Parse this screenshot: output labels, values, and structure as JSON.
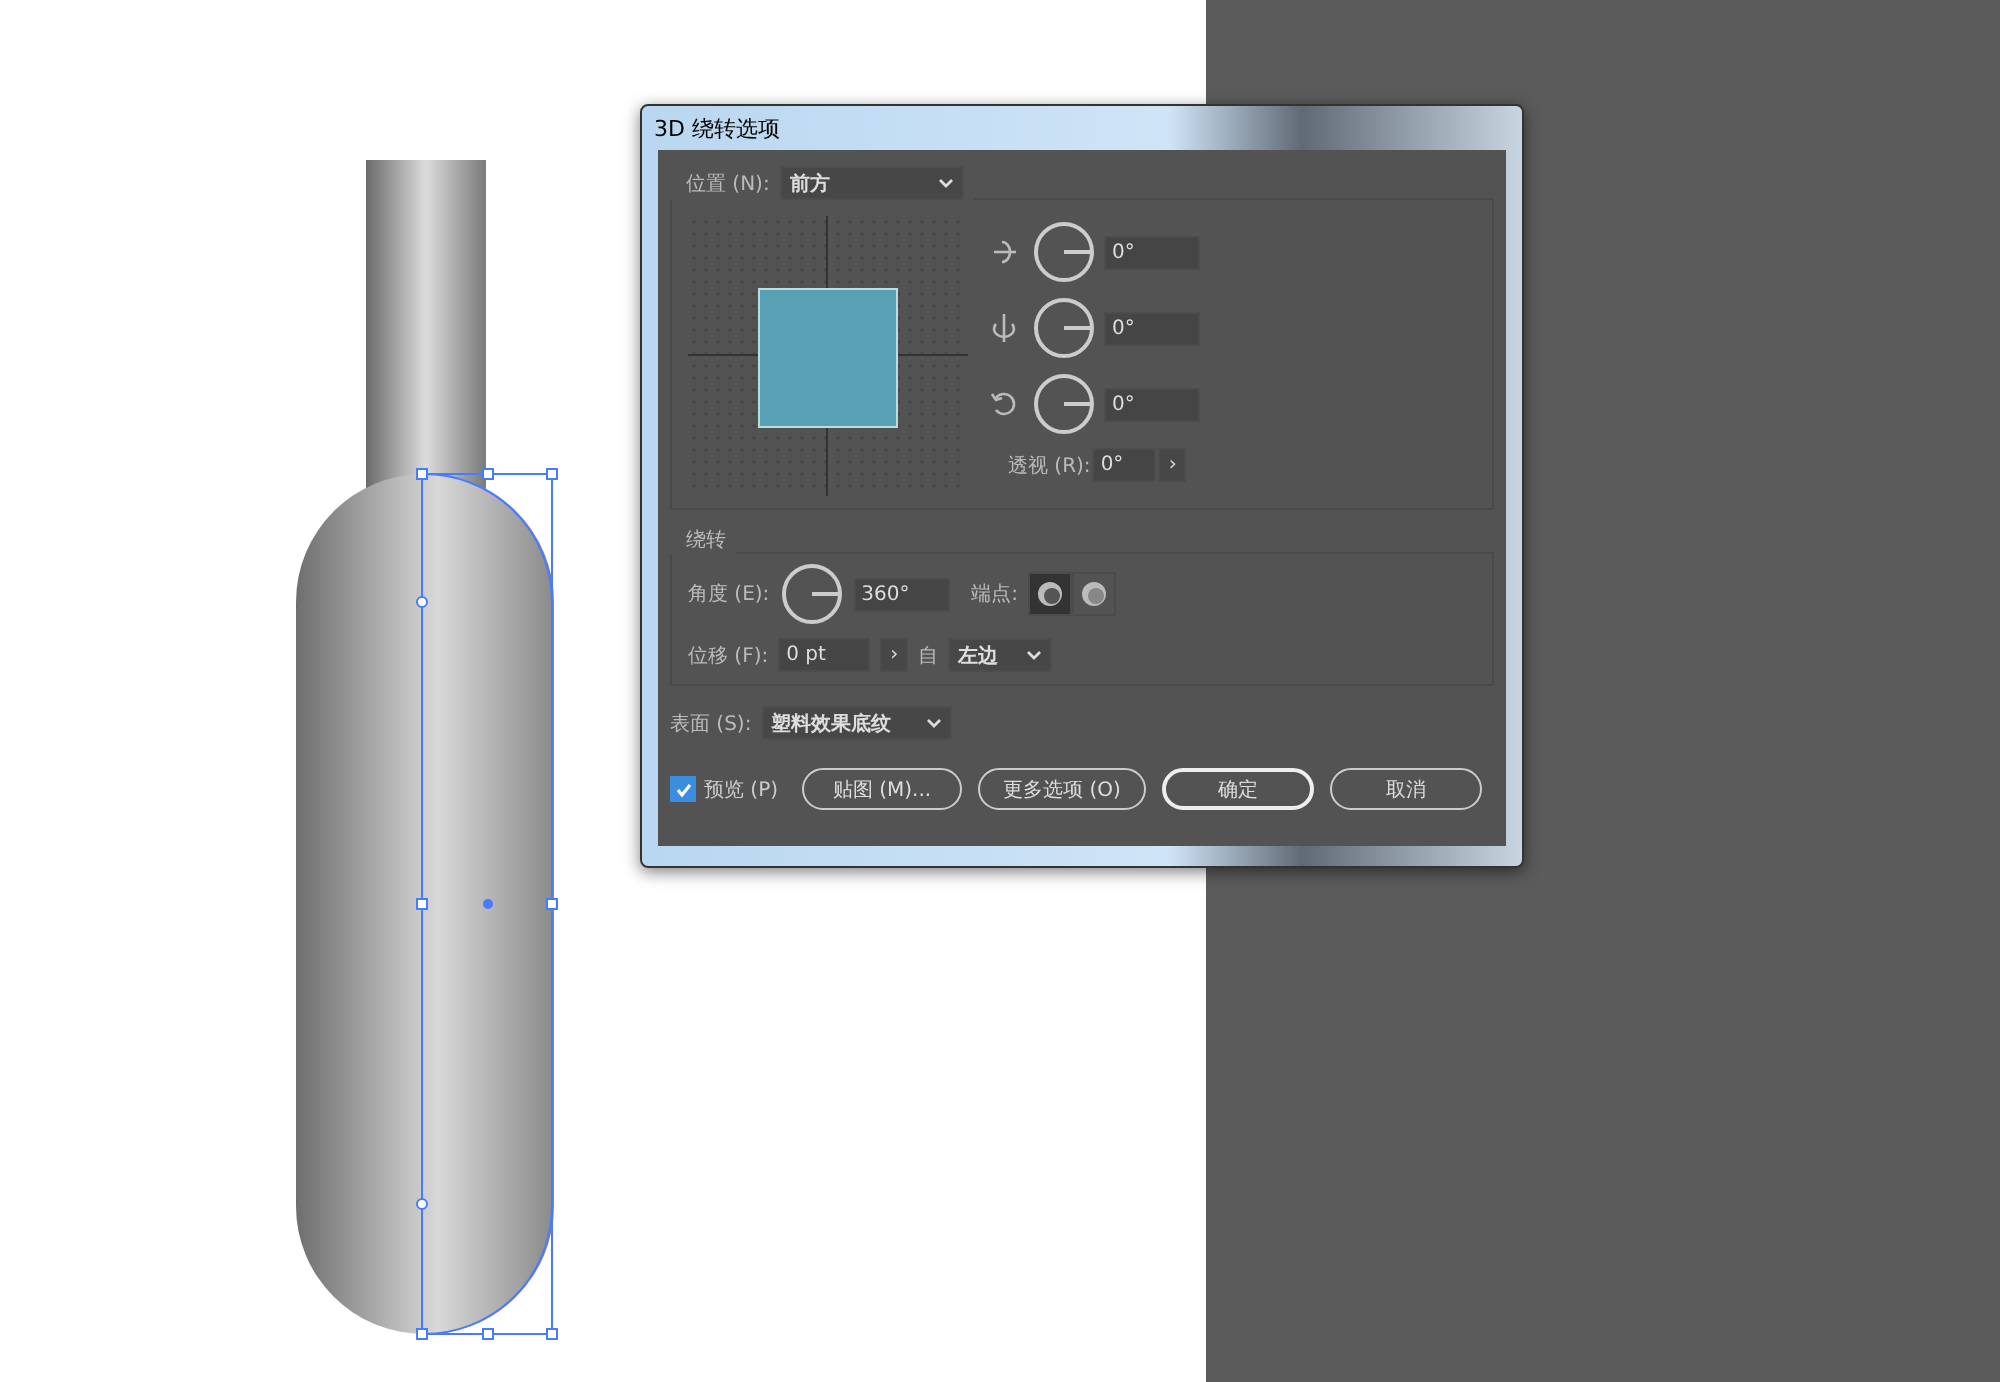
{
  "dialog": {
    "title": "3D 绕转选项",
    "position": {
      "label": "位置 (N):",
      "value": "前方"
    },
    "rotations": [
      {
        "kind": "x",
        "value": "0°"
      },
      {
        "kind": "y",
        "value": "0°"
      },
      {
        "kind": "z",
        "value": "0°"
      }
    ],
    "perspective": {
      "label": "透视 (R):",
      "value": "0°",
      "button": "›"
    },
    "revolve": {
      "title": "绕转",
      "angle_label": "角度 (E):",
      "angle_value": "360°",
      "cap_label": "端点:",
      "caps": [
        {
          "kind": "on",
          "selected": true
        },
        {
          "kind": "off",
          "selected": false
        }
      ],
      "offset_label": "位移 (F):",
      "offset_value": "0 pt",
      "offset_button": "›",
      "from_label": "自",
      "from_value": "左边"
    },
    "surface": {
      "label": "表面 (S):",
      "value": "塑料效果底纹"
    },
    "preview": {
      "label": "预览 (P)",
      "checked": true
    },
    "buttons": [
      {
        "label": "贴图 (M)...",
        "kind": "normal"
      },
      {
        "label": "更多选项 (O)",
        "kind": "normal"
      },
      {
        "label": "确定",
        "kind": "default"
      },
      {
        "label": "取消",
        "kind": "normal"
      }
    ]
  }
}
